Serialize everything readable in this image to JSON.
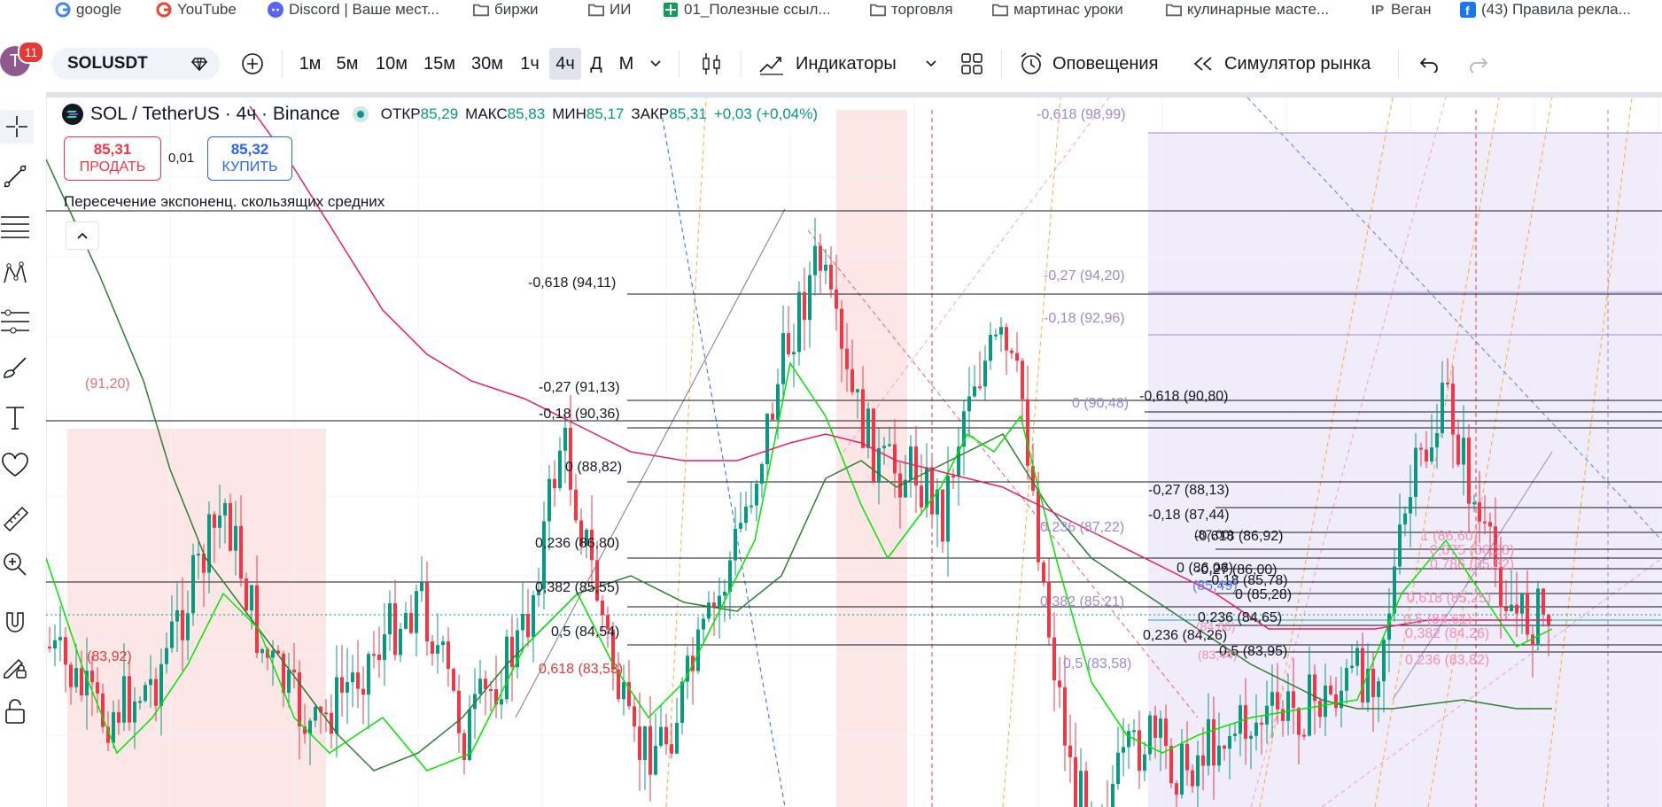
{
  "bookmarks": [
    {
      "label": "google",
      "icon": "google-icon"
    },
    {
      "label": "YouTube",
      "icon": "google-icon"
    },
    {
      "label": "Discord | Ваше мест...",
      "icon": "discord-icon"
    },
    {
      "label": "биржи",
      "icon": "folder-icon"
    },
    {
      "label": "ИИ",
      "icon": "folder-icon"
    },
    {
      "label": "01_Полезные ссыл...",
      "icon": "sheets-icon"
    },
    {
      "label": "торговля",
      "icon": "folder-icon"
    },
    {
      "label": "мартинас уроки",
      "icon": "folder-icon"
    },
    {
      "label": "кулинарные масте...",
      "icon": "folder-icon"
    },
    {
      "label": "Веган",
      "icon": "ip-icon"
    },
    {
      "label": "(43) Правила рекла...",
      "icon": "facebook-icon"
    }
  ],
  "user": {
    "avatar_letter": "T",
    "notifications": "11"
  },
  "toolbar": {
    "symbol": "SOLUSDT",
    "intervals": [
      "1м",
      "5м",
      "10м",
      "15м",
      "30м",
      "1ч",
      "4ч",
      "Д",
      "М"
    ],
    "active_interval": "4ч",
    "indicators_label": "Индикаторы",
    "alerts_label": "Оповещения",
    "replay_label": "Симулятор рынка"
  },
  "legend": {
    "title": "SOL / TetherUS · 4ч · Binance",
    "open_label": "ОТКР",
    "open": "85,29",
    "high_label": "МАКС",
    "high": "85,83",
    "low_label": "МИН",
    "low": "85,17",
    "close_label": "ЗАКР",
    "close": "85,31",
    "change": "+0,03 (+0,04%)"
  },
  "trade": {
    "sell_price": "85,31",
    "sell_label": "ПРОДАТЬ",
    "spread": "0,01",
    "buy_price": "85,32",
    "buy_label": "КУПИТЬ"
  },
  "indicator": {
    "name": "Пересечение экспоненц. скользящих средних"
  },
  "colors": {
    "up": "#089981",
    "down": "#f23645",
    "accent": "#2962ff",
    "fib_purple": "#9c88d4",
    "ema_fast": "#00e600",
    "ema_mid": "#2e7d32",
    "ema_slow": "#e91e63"
  },
  "chart_data": {
    "type": "candlestick",
    "fib_labels_black": [
      "-0,618 (94,11)",
      "-0,27 (91,13)",
      "-0,18 (90,36)",
      "0 (88,82)",
      "0,236 (86,80)",
      "0,382 (85,55)",
      "0,5 (84,54)",
      "-0,618 (90,80)",
      "-0,27 (88,13)",
      "-0,18 (87,44)",
      "-0,618 (86,92)",
      "0 (86,06)",
      "-0,27 (86,00)",
      "-0,18 (85,78)",
      "0 (85,28)",
      "0,236 (84,65)",
      "0,236 (84,26)",
      "0,5 (83,95)"
    ],
    "fib_labels_red": [
      "0,618 (83,53)",
      "(83,92)",
      "(91,20)"
    ],
    "fib_labels_purple": [
      "-0,618 (98,99)",
      "-0,27 (94,20)",
      "-0,18 (92,96)",
      "0 (90,48)",
      "0,236 (87,22)",
      "0,382 (85,21)",
      "0,5 (83,58)",
      "(85,49)"
    ],
    "fib_labels_pink": [
      "0,875 (86,28)",
      "0,786 (85,82)",
      "0,618 (85,25)",
      "0,5 (84,61)",
      "0,382 (84,26)",
      "0,236 (83,82)",
      "1 (86,60)"
    ],
    "fib_labels_small": [
      "(87,00)",
      "(84,60)",
      "(83,44)"
    ]
  }
}
